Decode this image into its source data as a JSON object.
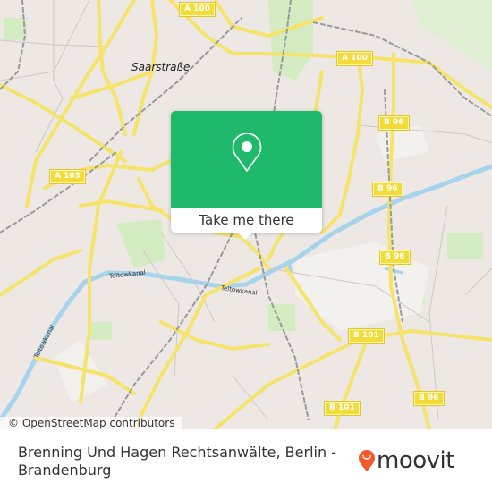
{
  "map": {
    "place_labels": [
      {
        "name": "Saarstraße"
      }
    ],
    "road_shields": [
      {
        "label": "A 100"
      },
      {
        "label": "A 100"
      },
      {
        "label": "A 103"
      },
      {
        "label": "B 96"
      },
      {
        "label": "B 96"
      },
      {
        "label": "B 96"
      },
      {
        "label": "B 101"
      },
      {
        "label": "B 101"
      },
      {
        "label": "B 96"
      }
    ],
    "water_labels": [
      {
        "name": "Teltowkanal"
      },
      {
        "name": "Teltowkanal"
      },
      {
        "name": "Teltowkanal"
      }
    ],
    "colors": {
      "land": "#ede8e4",
      "park": "#d4ecc1",
      "water": "#a7d3ec",
      "major_road": "#f6e36a",
      "rail": "#999999"
    }
  },
  "popup": {
    "icon": "map-pin-icon",
    "button_label": "Take me there",
    "color": "#1fb96b"
  },
  "attribution": "© OpenStreetMap contributors",
  "footer": {
    "place_title": "Brenning Und Hagen Rechtsanwälte, Berlin - Brandenburg",
    "brand": "moovit",
    "brand_icon": "moovit-pin-icon",
    "brand_color": "#f15a2a"
  }
}
